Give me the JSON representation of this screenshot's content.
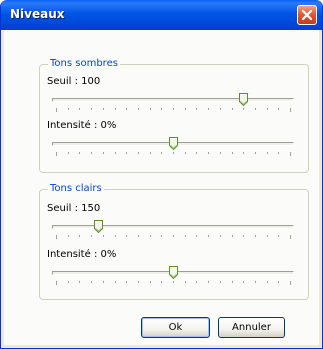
{
  "window": {
    "title": "Niveaux",
    "close_icon": "close-x-icon"
  },
  "groups": [
    {
      "legend": "Tons sombres",
      "threshold_label": "Seuil : 100",
      "threshold_value": 0.8,
      "intensity_label": "Intensité : 0%",
      "intensity_value": 0.5
    },
    {
      "legend": "Tons clairs",
      "threshold_label": "Seuil : 150",
      "threshold_value": 0.18,
      "intensity_label": "Intensité : 0%",
      "intensity_value": 0.5
    }
  ],
  "buttons": {
    "ok": "Ok",
    "cancel": "Annuler"
  },
  "colors": {
    "title_bar": "#0055e5",
    "group_legend": "#0046d5",
    "close_button": "#e1593b"
  }
}
